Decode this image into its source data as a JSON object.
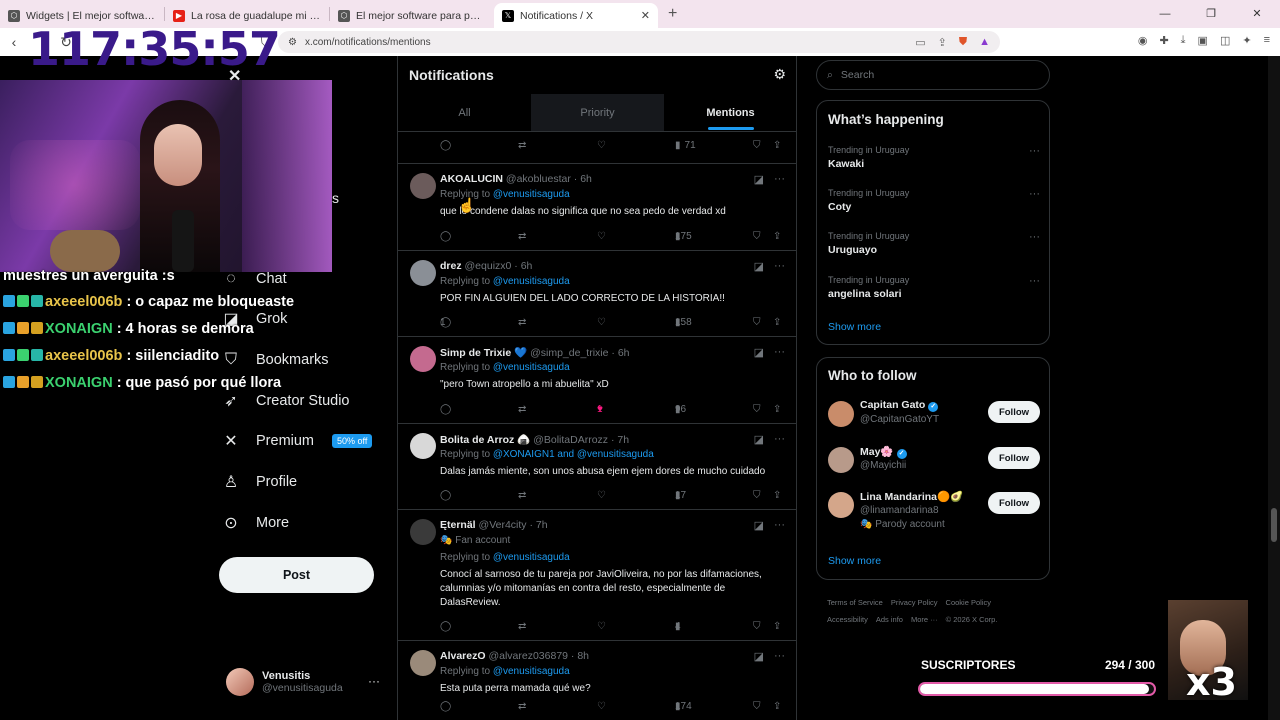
{
  "browser": {
    "tabs": [
      {
        "title": "Widgets | El mejor software para potenciar tu stream"
      },
      {
        "title": "La rosa de guadalupe mi hijo es negro"
      },
      {
        "title": "El mejor software para potenciar tu stream"
      },
      {
        "title": "Notifications / X"
      }
    ],
    "url": "x.com/notifications/mentions"
  },
  "stream": {
    "timer": "117:35:57",
    "chat": [
      {
        "user": "",
        "msg": "muestres un averguita :s"
      },
      {
        "user": "axeeel006b",
        "msg": ": o capaz me bloqueaste"
      },
      {
        "user": "XONAIGN",
        "msg": ": 4 horas se demora"
      },
      {
        "user": "axeeel006b",
        "msg": ": siilenciadito"
      },
      {
        "user": "XONAIGN",
        "msg": ": que pasó por qué llora"
      }
    ],
    "subs_label": "SUSCRIPTORES",
    "subs_count": "294 / 300",
    "subs_progress": 0.98,
    "multiplier": "x3"
  },
  "nav": {
    "partial": "s",
    "items": [
      {
        "label": "Chat",
        "icon": "chat-icon"
      },
      {
        "label": "Grok",
        "icon": "grok-icon"
      },
      {
        "label": "Bookmarks",
        "icon": "bookmark-icon"
      },
      {
        "label": "Creator Studio",
        "icon": "rocket-icon"
      },
      {
        "label": "Premium",
        "icon": "x-icon",
        "badge": "50% off"
      },
      {
        "label": "Profile",
        "icon": "person-icon"
      },
      {
        "label": "More",
        "icon": "more-circle-icon"
      }
    ],
    "post": "Post",
    "account": {
      "name": "Venusitis",
      "handle": "@venusitisaguda"
    }
  },
  "notifications": {
    "title": "Notifications",
    "tabs": [
      "All",
      "Priority",
      "Mentions"
    ],
    "active_tab": "Mentions",
    "top_views": "71",
    "tweets": [
      {
        "name": "AKOALUCIN",
        "handle": "@akobluestar",
        "time": "6h",
        "reply_to": "@venusitisaguda",
        "text": "que lo condene dalas no significa que no sea pedo de verdad xd",
        "replies": "",
        "likes": "",
        "views": "175",
        "avatar": "#6b5b5b"
      },
      {
        "name": "drez",
        "handle": "@equizx0",
        "time": "6h",
        "reply_to": "@venusitisaguda",
        "text": "POR FIN ALGUIEN DEL LADO CORRECTO DE LA HISTORIA!!",
        "replies": "1",
        "likes": "",
        "views": "158",
        "avatar": "#8a8f96"
      },
      {
        "name": "Simp de Trixie 💙",
        "handle": "@simp_de_trixie",
        "time": "6h",
        "reply_to": "@venusitisaguda",
        "text": "\"pero Town atropello a mi abuelita\" xD",
        "replies": "",
        "likes": "1",
        "views": "96",
        "avatar": "#c46a8f"
      },
      {
        "name": "Bolita de Arroz 🍙",
        "handle": "@BolitaDArrozz",
        "time": "7h",
        "reply_to": "@XONAIGN1 and @venusitisaguda",
        "text": "Dalas jamás miente, son unos abusa ejem ejem dores de mucho cuidado",
        "replies": "",
        "likes": "",
        "views": "17",
        "avatar": "#d8d8d8"
      },
      {
        "name": "Ęternäl",
        "handle": "@Ver4city",
        "time": "7h",
        "fan": "Fan account",
        "reply_to": "@venusitisaguda",
        "text": "Conocí al sarnoso de tu pareja por JaviOliveira, no por las difamaciones, calumnias y/o mitomanías en contra del resto, especialmente de DalasReview.",
        "replies": "",
        "likes": "",
        "views": "4",
        "avatar": "#3a3a3a"
      },
      {
        "name": "AlvarezO",
        "handle": "@alvarez036879",
        "time": "8h",
        "reply_to": "@venusitisaguda",
        "text": "Esta puta perra mamada qué we?",
        "replies": "",
        "likes": "",
        "views": "174",
        "avatar": "#9a8a7a"
      }
    ]
  },
  "sidebar": {
    "search_placeholder": "Search",
    "happening_title": "What’s happening",
    "trends": [
      {
        "context": "Trending in Uruguay",
        "name": "Kawaki"
      },
      {
        "context": "Trending in Uruguay",
        "name": "Coty"
      },
      {
        "context": "Trending in Uruguay",
        "name": "Uruguayo"
      },
      {
        "context": "Trending in Uruguay",
        "name": "angelina solari"
      }
    ],
    "show_more": "Show more",
    "who_title": "Who to follow",
    "follow": [
      {
        "name": "Capitan Gato",
        "handle": "@CapitanGatoYT",
        "verified": true,
        "avatar": "#c98c6a"
      },
      {
        "name": "May🌸",
        "handle": "@Mayichii",
        "verified": true,
        "avatar": "#b89a8a"
      },
      {
        "name": "Lina Mandarina🟠🥑",
        "handle": "@linamandarina8",
        "verified": false,
        "parody": "Parody account",
        "avatar": "#d4a68a"
      }
    ],
    "follow_label": "Follow",
    "footer": [
      "Terms of Service",
      "Privacy Policy",
      "Cookie Policy",
      "Accessibility",
      "Ads info",
      "More ···",
      "© 2026 X Corp."
    ]
  }
}
